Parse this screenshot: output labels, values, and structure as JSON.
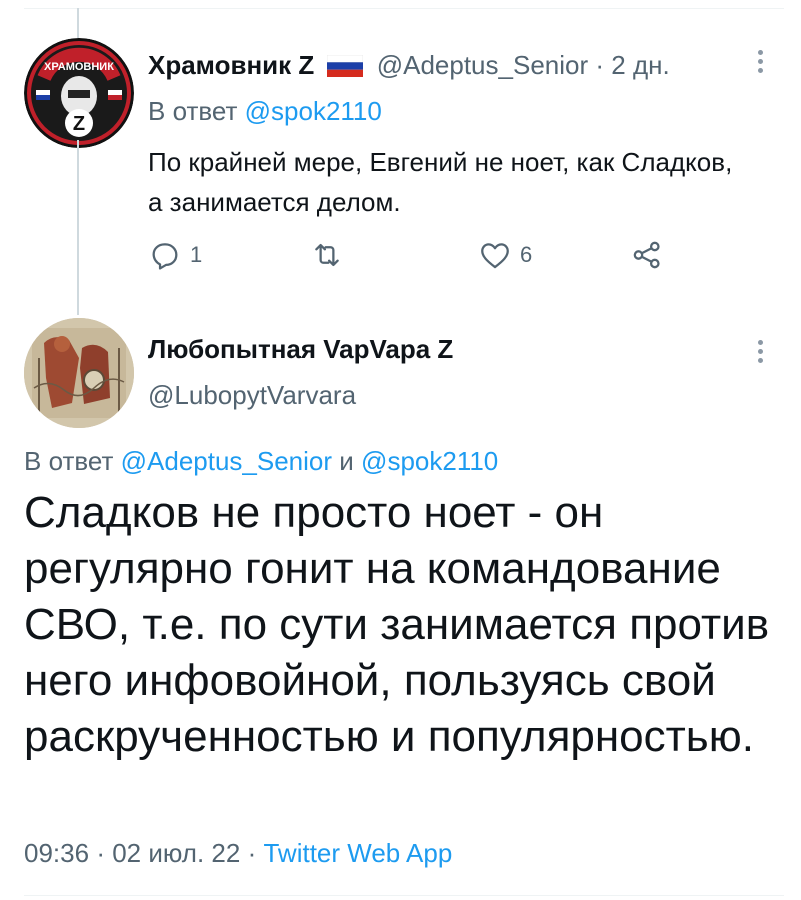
{
  "tweet1": {
    "author_name": "Храмовник Z",
    "flag_icon": "russia-flag-icon",
    "handle": "@Adeptus_Senior",
    "separator": "·",
    "time": "2 дн.",
    "reply_prefix": "В ответ",
    "reply_to": "@spok2110",
    "text": "По крайней мере, Евгений не ноет, как Сладков, а занимается делом.",
    "replies": "1",
    "retweets": "",
    "likes": "6",
    "avatar_text": "ХРАМОВНИК"
  },
  "tweet2": {
    "author_name": "Любопытная VapVapa Z",
    "handle": "@LubopytVarvara",
    "reply_prefix": "В ответ",
    "reply_to_1": "@Adeptus_Senior",
    "reply_conj": "и",
    "reply_to_2": "@spok2110",
    "text": "Сладков не просто ноет - он регулярно гонит на командование СВО, т.е. по сути занимается против него инфовойной, пользуясь свой раскрученностью и популярностью.",
    "time": "09:36",
    "date": "02 июл. 22",
    "source": "Twitter Web App"
  },
  "colors": {
    "text": "#0f1419",
    "secondary": "#536471",
    "link": "#1d9bf0",
    "thread_line": "#cfd9de"
  }
}
